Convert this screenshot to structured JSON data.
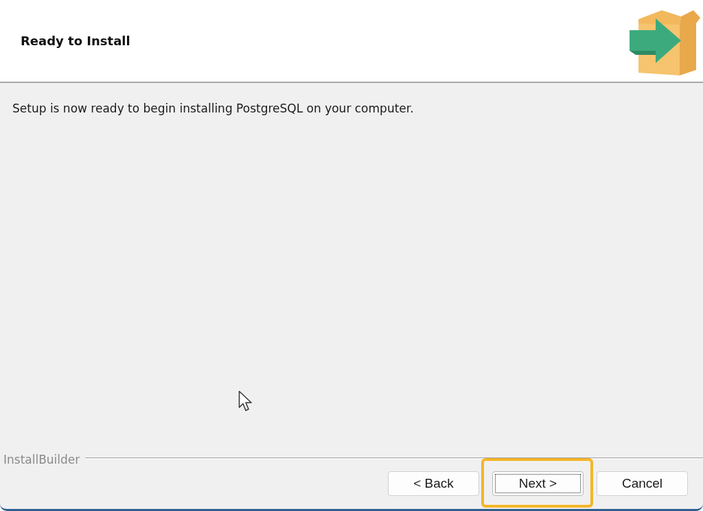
{
  "header": {
    "title": "Ready to Install"
  },
  "message": "Setup is now ready to begin installing PostgreSQL on your computer.",
  "footer": {
    "brand": "InstallBuilder"
  },
  "buttons": [
    {
      "label": "< Back",
      "focused": false,
      "highlighted": false
    },
    {
      "label": "Next >",
      "focused": true,
      "highlighted": true
    },
    {
      "label": "Cancel",
      "focused": false,
      "highlighted": false
    }
  ]
}
